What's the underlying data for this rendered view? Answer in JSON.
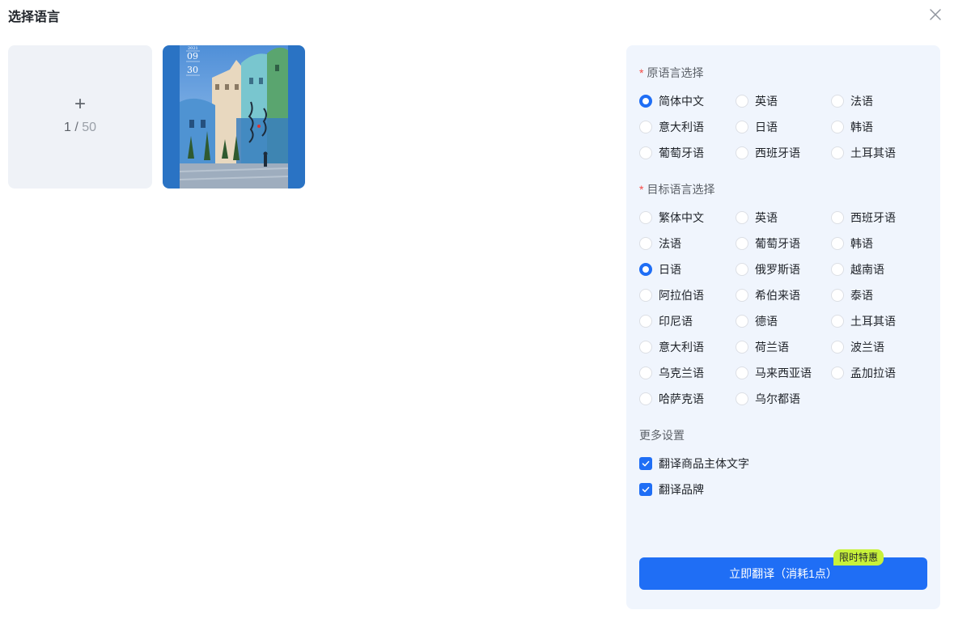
{
  "dialog": {
    "title": "选择语言"
  },
  "upload": {
    "plus": "+",
    "count": "1",
    "separator": " / ",
    "max": "50"
  },
  "thumbnail": {
    "date_line1": "2021",
    "date_line2": "09",
    "date_line3": "30",
    "colors": {
      "frame": "#2a73c4",
      "sky": "#6ea7e0"
    }
  },
  "source": {
    "label": "原语言选择",
    "required_mark": "*",
    "selected": "简体中文",
    "options": [
      "简体中文",
      "英语",
      "法语",
      "意大利语",
      "日语",
      "韩语",
      "葡萄牙语",
      "西班牙语",
      "土耳其语"
    ]
  },
  "target": {
    "label": "目标语言选择",
    "required_mark": "*",
    "selected": "日语",
    "options": [
      "繁体中文",
      "英语",
      "西班牙语",
      "法语",
      "葡萄牙语",
      "韩语",
      "日语",
      "俄罗斯语",
      "越南语",
      "阿拉伯语",
      "希伯来语",
      "泰语",
      "印尼语",
      "德语",
      "土耳其语",
      "意大利语",
      "荷兰语",
      "波兰语",
      "乌克兰语",
      "马来西亚语",
      "孟加拉语",
      "哈萨克语",
      "乌尔都语"
    ]
  },
  "more": {
    "label": "更多设置",
    "options": [
      {
        "label": "翻译商品主体文字",
        "checked": true
      },
      {
        "label": "翻译品牌",
        "checked": true
      }
    ]
  },
  "action": {
    "button_label": "立即翻译（消耗1点）",
    "badge": "限时特惠"
  },
  "colors": {
    "accent": "#1f6ef5",
    "panel_bg": "#f0f5fd",
    "badge_bg": "#c8f13a",
    "required": "#f54a45"
  }
}
